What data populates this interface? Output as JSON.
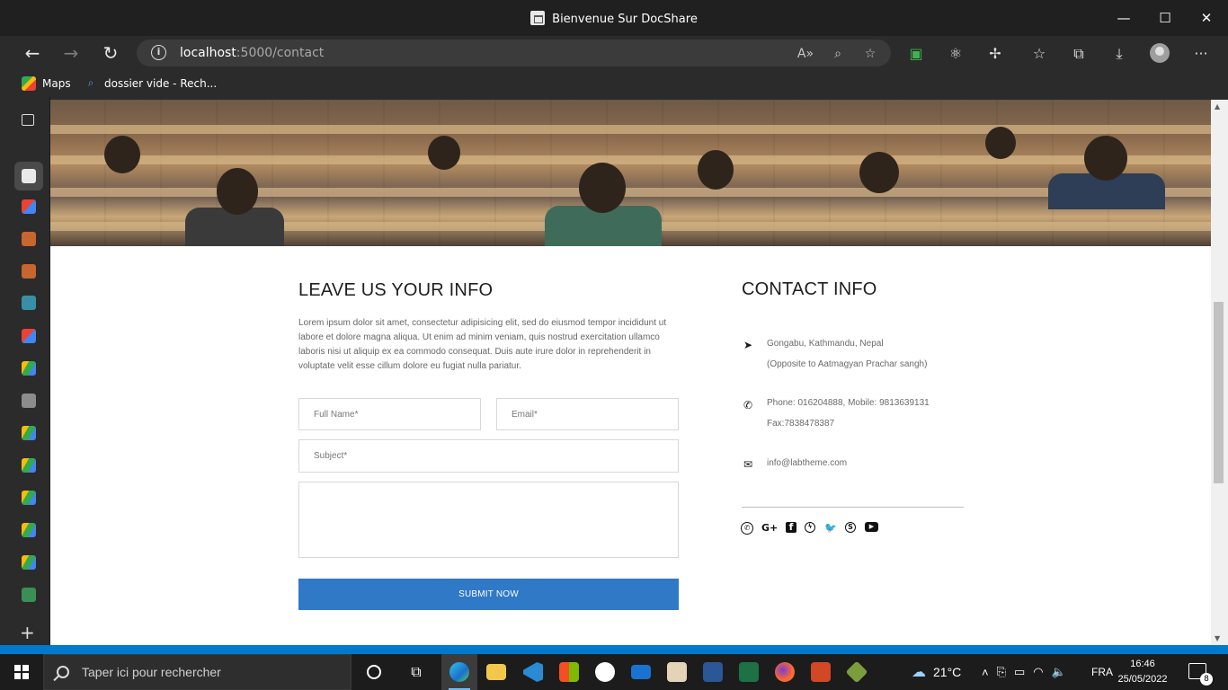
{
  "window": {
    "title": "Bienvenue Sur DocShare",
    "minimize": "—",
    "maximize": "☐",
    "close": "✕"
  },
  "toolbar": {
    "back": "←",
    "forward": "→",
    "refresh": "↻",
    "url_host": "localhost",
    "url_rest": ":5000/contact",
    "more": "···"
  },
  "favorites": [
    {
      "label": "Maps",
      "icon": "maps-icon"
    },
    {
      "label": "dossier vide - Rech...",
      "icon": "search-icon"
    }
  ],
  "page": {
    "form_title": "LEAVE US YOUR INFO",
    "lorem": "Lorem ipsum dolor sit amet, consectetur adipisicing elit, sed do eiusmod tempor incididunt ut labore et dolore magna aliqua. Ut enim ad minim veniam, quis nostrud exercitation ullamco laboris nisi ut aliquip ex ea commodo consequat. Duis aute irure dolor in reprehenderit in voluptate velit esse cillum dolore eu fugiat nulla pariatur.",
    "fullname_placeholder": "Full Name*",
    "email_placeholder": "Email*",
    "subject_placeholder": "Subject*",
    "message_value": "",
    "submit_label": "SUBMIT NOW",
    "contact_title": "CONTACT INFO",
    "address_line1": "Gongabu, Kathmandu, Nepal",
    "address_line2": "(Opposite to Aatmagyan Prachar sangh)",
    "phone_line1": "Phone: 016204888, Mobile: 9813639131",
    "phone_line2": "Fax:7838478387",
    "email": "info@labtheme.com",
    "socials": [
      "viber-icon",
      "google-plus-icon",
      "facebook-icon",
      "messenger-icon",
      "twitter-icon",
      "skype-icon",
      "youtube-icon"
    ]
  },
  "taskbar": {
    "search_placeholder": "Taper ici pour rechercher",
    "weather": "21°C",
    "language": "FRA",
    "time": "16:46",
    "date": "25/05/2022",
    "notifications": "8"
  },
  "colors": {
    "accent": "#3079c6",
    "edge_dark": "#202020",
    "taskbar": "#1c1c1c"
  }
}
